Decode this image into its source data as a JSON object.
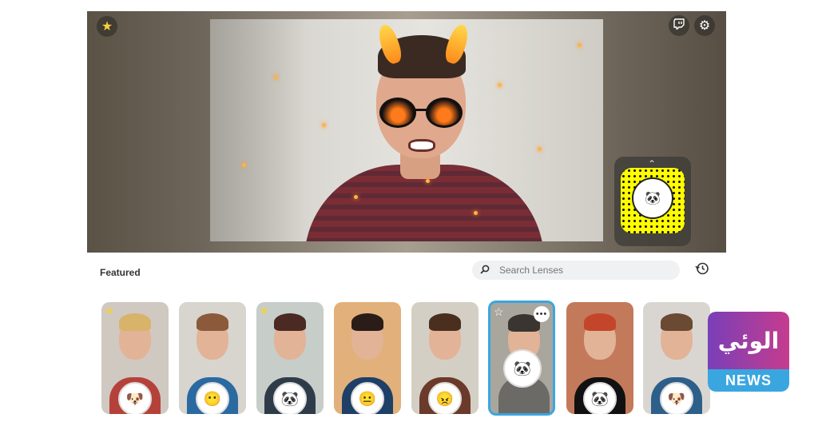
{
  "camera": {
    "favorite_icon": "star-icon",
    "twitch_icon": "twitch-icon",
    "settings_icon": "gear-icon"
  },
  "panel": {
    "title": "Featured",
    "search": {
      "placeholder": "Search Lenses",
      "value": ""
    },
    "history_icon": "history-icon"
  },
  "lenses": [
    {
      "favorited": true,
      "shirt": "#b5423a",
      "hair": "#d8b36a",
      "bg": "#cfc9c1",
      "badge": "🐶"
    },
    {
      "favorited": false,
      "shirt": "#2a6aa0",
      "hair": "#8a5a3a",
      "bg": "#d8d4ce",
      "badge": "😶"
    },
    {
      "favorited": true,
      "shirt": "#2e3c4a",
      "hair": "#4a2a22",
      "bg": "#c7cdc9",
      "badge": "🐼"
    },
    {
      "favorited": false,
      "shirt": "#1e3f66",
      "hair": "#2a1d18",
      "bg": "#e2b07a",
      "badge": "😐"
    },
    {
      "favorited": false,
      "shirt": "#6b3a2a",
      "hair": "#4a2f1f",
      "bg": "#d4cfc4",
      "badge": "😠"
    },
    {
      "favorited": false,
      "selected": true,
      "shirt": "#6b6a66",
      "hair": "#3a3530",
      "bg": "#a9a69d",
      "badge": "🐼"
    },
    {
      "favorited": false,
      "shirt": "#111",
      "hair": "#c4462a",
      "bg": "#c27a5a",
      "badge": "🐼"
    },
    {
      "favorited": false,
      "shirt": "#2d5f8a",
      "hair": "#6a4a32",
      "bg": "#d9d6d1",
      "badge": "🐶"
    }
  ],
  "watermark": {
    "brand_label": "NEWS",
    "logo_text": "الوئي نيوز"
  }
}
